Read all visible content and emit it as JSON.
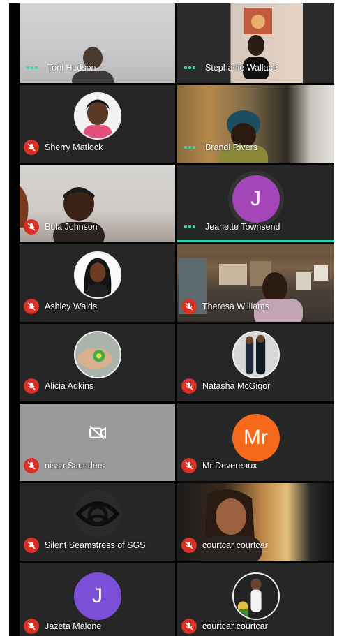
{
  "participants": [
    {
      "name": "Toni Hudson",
      "status": "speaking",
      "display": "video"
    },
    {
      "name": "Stephanie Wallace",
      "status": "speaking",
      "display": "video"
    },
    {
      "name": "Sherry Matlock",
      "status": "muted",
      "display": "photo-avatar"
    },
    {
      "name": "Brandi Rivers",
      "status": "speaking",
      "display": "video"
    },
    {
      "name": "Bula Johnson",
      "status": "muted",
      "display": "video"
    },
    {
      "name": "Jeanette Townsend",
      "status": "speaking",
      "display": "letter-avatar",
      "initials": "J",
      "color": "#a446b8"
    },
    {
      "name": "Ashley Walds",
      "status": "muted",
      "display": "photo-avatar"
    },
    {
      "name": "Theresa Williams",
      "status": "muted",
      "display": "video"
    },
    {
      "name": "Alicia Adkins",
      "status": "muted",
      "display": "photo-avatar"
    },
    {
      "name": "Natasha McGigor",
      "status": "muted",
      "display": "photo-avatar"
    },
    {
      "name": "nissa Saunders",
      "status": "muted",
      "display": "camera-off"
    },
    {
      "name": "Mr Devereaux",
      "status": "muted",
      "display": "letter-avatar",
      "initials": "Mr",
      "color": "#f5691b"
    },
    {
      "name": "Silent Seamstress of SGS",
      "status": "muted",
      "display": "logo-avatar"
    },
    {
      "name": "courtcar courtcar",
      "status": "muted",
      "display": "video"
    },
    {
      "name": "Jazeta Malone",
      "status": "muted",
      "display": "letter-avatar",
      "initials": "J",
      "color": "#7c4fd8"
    },
    {
      "name": "courtcar courtcar",
      "status": "muted",
      "display": "photo-avatar"
    }
  ],
  "icons": {
    "muted": "mic-off-icon",
    "speaking": "audio-level-dots-icon",
    "camera_off": "video-off-icon"
  },
  "colors": {
    "mic_badge": "#d93025",
    "speaking_indicator": "#3cd6b4",
    "tile_background": "#262626",
    "active_speaker_bar": "#28d4b0"
  }
}
